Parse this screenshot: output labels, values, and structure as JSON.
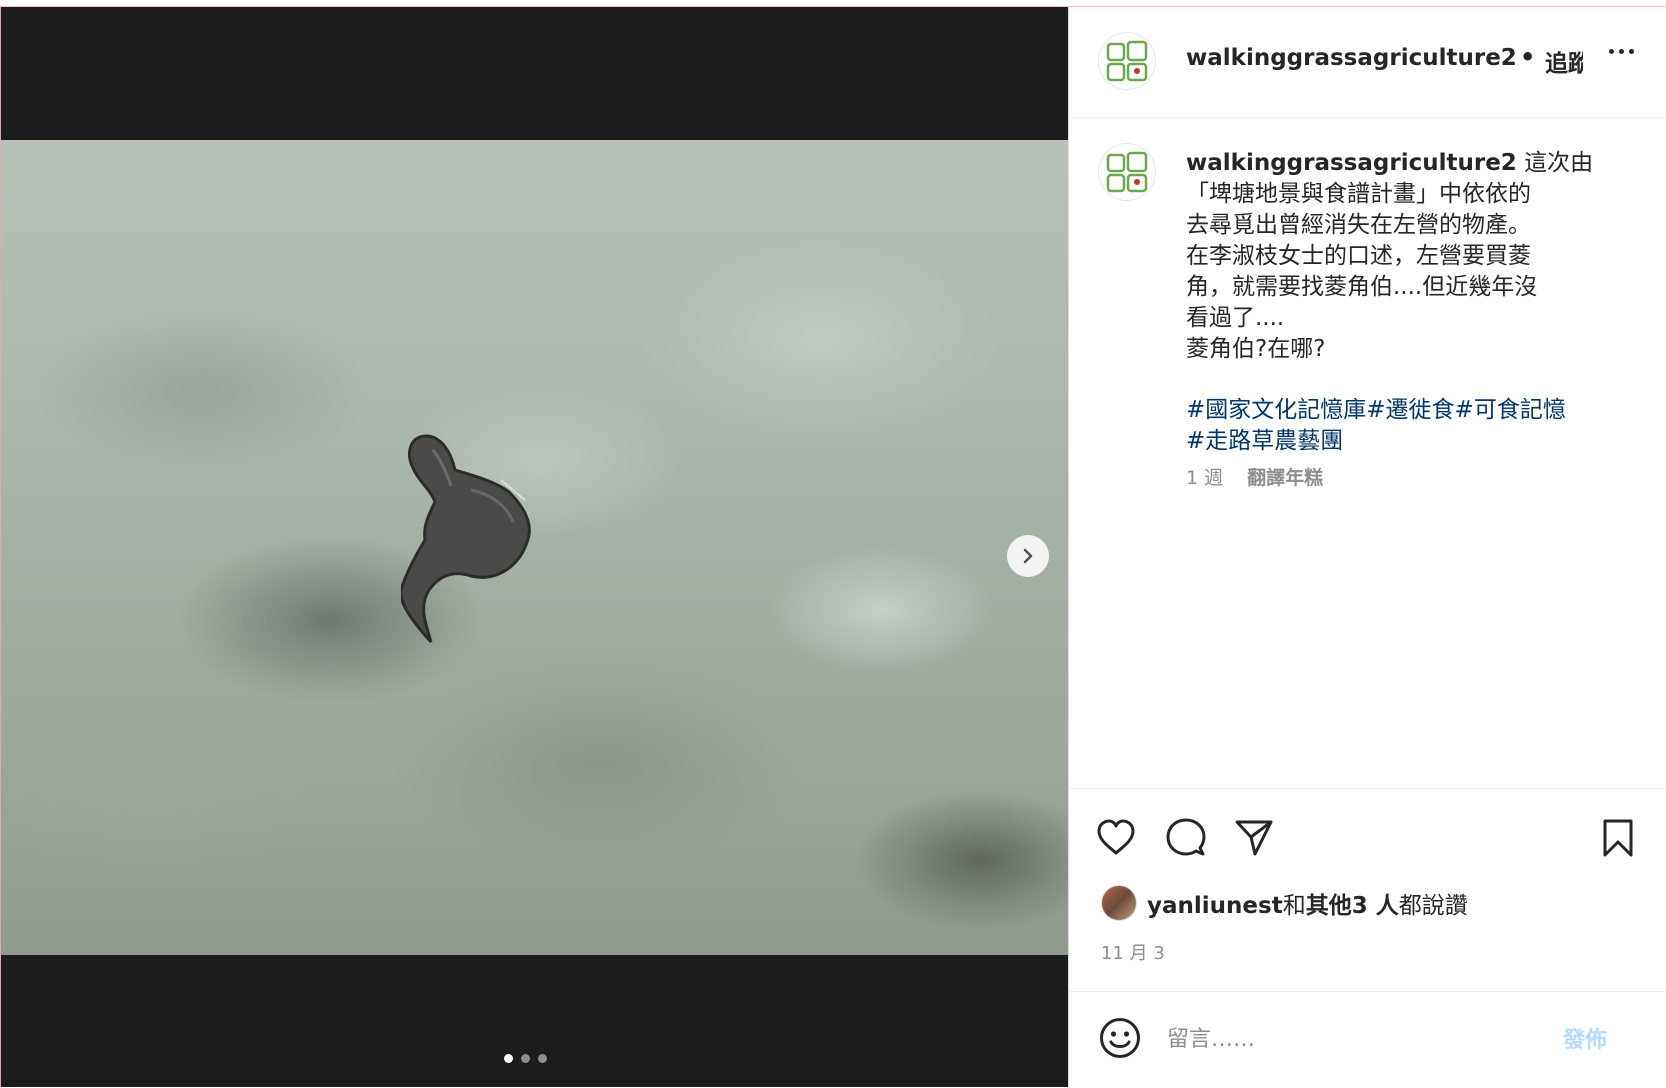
{
  "post": {
    "username": "walkinggrassagriculture2",
    "separator": "•",
    "follow_label": "追蹤",
    "carousel": {
      "total_slides": 3,
      "current_slide": 1
    },
    "caption": {
      "lines": [
        "這次由",
        "「埤塘地景與食譜計畫」中依依的",
        "去尋覓出曾經消失在左營的物產。",
        "在李淑枝女士的口述，左營要買菱",
        "角，就需要找菱角伯....但近幾年沒",
        "看過了....",
        "菱角伯?在哪?"
      ],
      "hashtags_line1": "#國家文化記憶庫#遷徙食#可食記憶",
      "hashtags_line2": "#走路草農藝團"
    },
    "time_ago": "1 週",
    "translate_label": "翻譯年糕",
    "likes": {
      "user": "yanliunest",
      "rest": "和",
      "others": "其他3 人",
      "suffix": "都說讚"
    },
    "date": "11 月 3",
    "comment": {
      "placeholder": "留言……",
      "post_label": "發佈"
    }
  },
  "icons": {
    "like": "heart-icon",
    "comment": "comment-icon",
    "share": "paper-plane-icon",
    "save": "bookmark-icon",
    "more": "more-horizontal-icon",
    "emoji": "emoji-icon",
    "next": "chevron-right-icon"
  },
  "colors": {
    "hashtag": "#00376b",
    "post_button_disabled": "#b3dbff",
    "muted": "#8e8e8e"
  }
}
